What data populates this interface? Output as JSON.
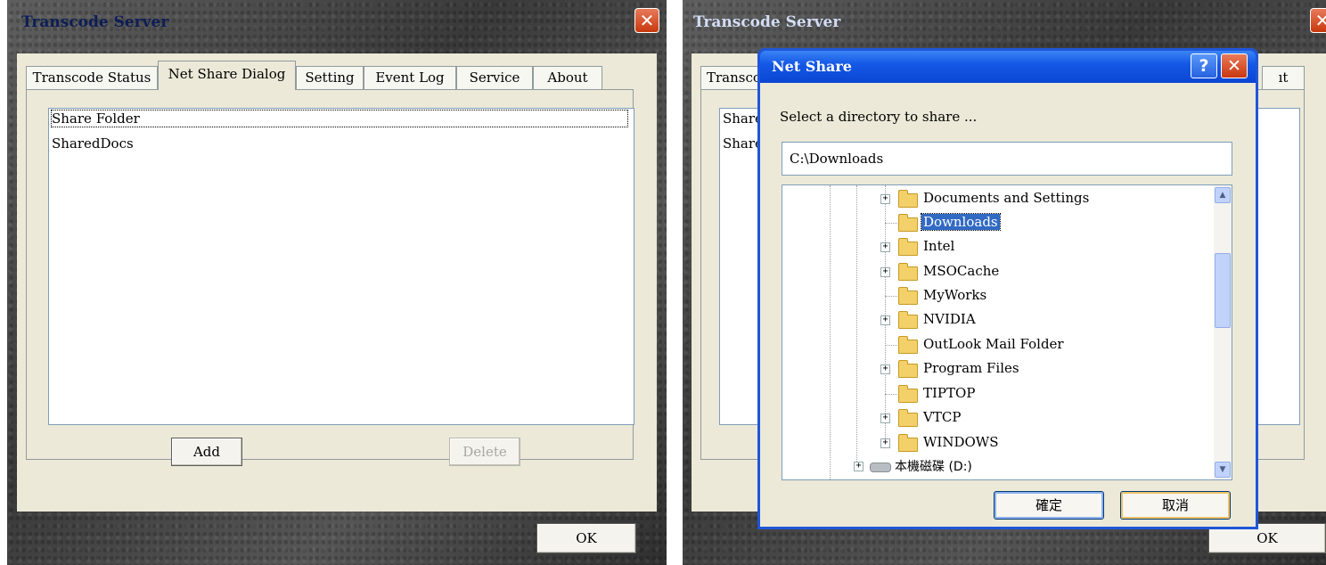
{
  "left_window": {
    "title": "Transcode Server",
    "close_glyph": "✕",
    "tabs": [
      {
        "label": "Transcode Status"
      },
      {
        "label": "Net Share Dialog"
      },
      {
        "label": "Setting"
      },
      {
        "label": "Event Log"
      },
      {
        "label": "Service"
      },
      {
        "label": "About"
      }
    ],
    "active_tab": "Net Share Dialog",
    "share_list": [
      "Share Folder",
      "SharedDocs"
    ],
    "add_label": "Add",
    "delete_label": "Delete",
    "ok_label": "OK"
  },
  "right_window": {
    "title": "Transcode Server",
    "close_glyph": "✕",
    "tab_visible_left": "Transco",
    "tab_visible_right": "ıt",
    "share_list_partial": [
      "Share",
      "Share"
    ],
    "ok_label": "OK"
  },
  "net_share_dialog": {
    "title": "Net Share",
    "help_glyph": "?",
    "close_glyph": "✕",
    "prompt": "Select a directory to share ...",
    "path_value": "C:\\Downloads",
    "tree": [
      {
        "label": "Documents and Settings",
        "expandable": true,
        "icon": "folder-icon"
      },
      {
        "label": "Downloads",
        "expandable": false,
        "icon": "folder-icon",
        "selected": true
      },
      {
        "label": "Intel",
        "expandable": true,
        "icon": "folder-icon"
      },
      {
        "label": "MSOCache",
        "expandable": true,
        "icon": "folder-icon"
      },
      {
        "label": "MyWorks",
        "expandable": false,
        "icon": "folder-icon"
      },
      {
        "label": "NVIDIA",
        "expandable": true,
        "icon": "folder-icon"
      },
      {
        "label": "OutLook Mail Folder",
        "expandable": false,
        "icon": "folder-icon"
      },
      {
        "label": "Program Files",
        "expandable": true,
        "icon": "folder-icon"
      },
      {
        "label": "TIPTOP",
        "expandable": false,
        "icon": "folder-icon"
      },
      {
        "label": "VTCP",
        "expandable": true,
        "icon": "folder-icon"
      },
      {
        "label": "WINDOWS",
        "expandable": true,
        "icon": "folder-icon"
      },
      {
        "label": "本機磁碟 (D:)",
        "expandable": true,
        "icon": "drive-icon"
      }
    ],
    "scroll_up_glyph": "▲",
    "scroll_down_glyph": "▼",
    "ok_label": "確定",
    "cancel_label": "取消"
  }
}
